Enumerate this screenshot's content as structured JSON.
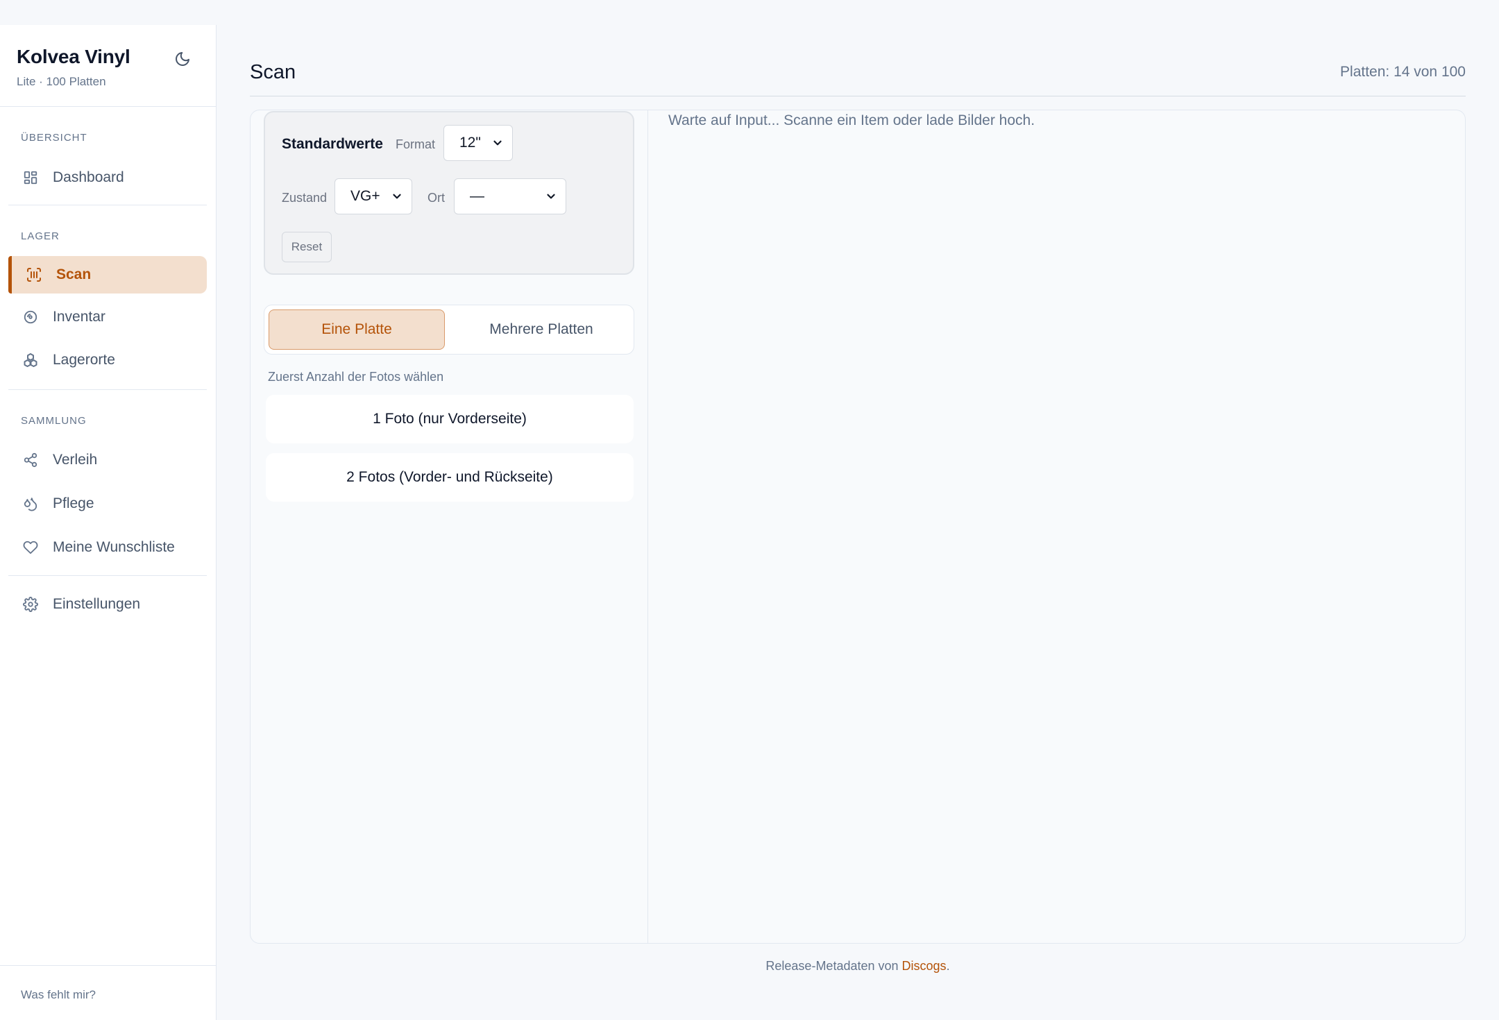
{
  "sidebar": {
    "brand_title": "Kolvea Vinyl",
    "brand_sub": "Lite · 100 Platten",
    "theme_icon": "moon-icon",
    "sections": {
      "overview": "ÜBERSICHT",
      "storage": "LAGER",
      "collection": "SAMMLUNG"
    },
    "items": {
      "dashboard": "Dashboard",
      "scan": "Scan",
      "inventory": "Inventar",
      "locations": "Lagerorte",
      "lending": "Verleih",
      "care": "Pflege",
      "wishlist": "Meine Wunschliste",
      "settings": "Einstellungen"
    },
    "footer": "Was fehlt mir?"
  },
  "header": {
    "title": "Scan",
    "count": "Platten: 14 von 100"
  },
  "defaults": {
    "title": "Standardwerte",
    "format_label": "Format",
    "format_value": "12\"",
    "condition_label": "Zustand",
    "condition_value": "VG+",
    "location_label": "Ort",
    "location_value": "—",
    "reset_label": "Reset"
  },
  "mode": {
    "single": "Eine Platte",
    "multi": "Mehrere Platten"
  },
  "photos": {
    "hint": "Zuerst Anzahl der Fotos wählen",
    "one": "1 Foto (nur Vorderseite)",
    "two": "2 Fotos (Vorder- und Rückseite)"
  },
  "status_text": "Warte auf Input... Scanne ein Item oder lade Bilder hoch.",
  "footer": {
    "prefix": "Release-Metadaten von ",
    "link": "Discogs",
    "suffix": "."
  },
  "colors": {
    "accent": "#b45309",
    "accent_bg": "#f3dfce",
    "background": "#f6f8fb"
  }
}
